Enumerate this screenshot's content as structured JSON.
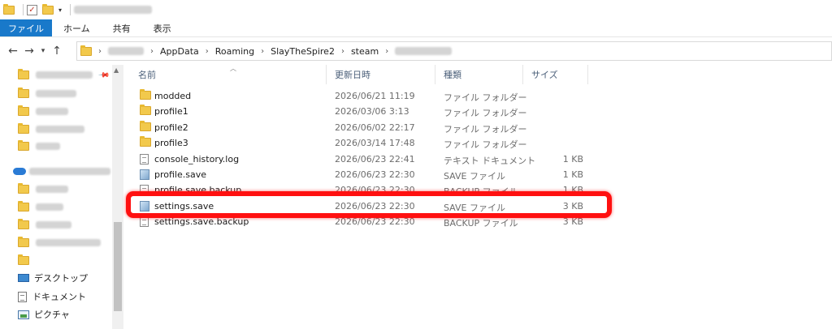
{
  "ribbon": {
    "tabs": [
      "ファイル",
      "ホーム",
      "共有",
      "表示"
    ]
  },
  "address": {
    "crumbs": [
      "AppData",
      "Roaming",
      "SlayTheSpire2",
      "steam"
    ]
  },
  "nav_pane": {
    "items": [
      "デスクトップ",
      "ドキュメント",
      "ピクチャ"
    ]
  },
  "columns": {
    "name": "名前",
    "date": "更新日時",
    "type": "種類",
    "size": "サイズ"
  },
  "files": [
    {
      "name": "modded",
      "date": "2026/06/21 11:19",
      "type": "ファイル フォルダー",
      "size": "",
      "icon": "folder-icon"
    },
    {
      "name": "profile1",
      "date": "2026/03/06 3:13",
      "type": "ファイル フォルダー",
      "size": "",
      "icon": "folder-icon"
    },
    {
      "name": "profile2",
      "date": "2026/06/02 22:17",
      "type": "ファイル フォルダー",
      "size": "",
      "icon": "folder-icon"
    },
    {
      "name": "profile3",
      "date": "2026/03/14 17:48",
      "type": "ファイル フォルダー",
      "size": "",
      "icon": "folder-icon"
    },
    {
      "name": "console_history.log",
      "date": "2026/06/23 22:41",
      "type": "テキスト ドキュメント",
      "size": "1 KB",
      "icon": "text-file-icon"
    },
    {
      "name": "profile.save",
      "date": "2026/06/23 22:30",
      "type": "SAVE ファイル",
      "size": "1 KB",
      "icon": "save-file-icon"
    },
    {
      "name": "profile.save.backup",
      "date": "2026/06/23 22:30",
      "type": "BACKUP ファイル",
      "size": "1 KB",
      "icon": "text-file-icon"
    },
    {
      "name": "settings.save",
      "date": "2026/06/23 22:30",
      "type": "SAVE ファイル",
      "size": "3 KB",
      "icon": "save-file-icon"
    },
    {
      "name": "settings.save.backup",
      "date": "2026/06/23 22:30",
      "type": "BACKUP ファイル",
      "size": "3 KB",
      "icon": "text-file-icon"
    }
  ],
  "colors": {
    "ribbon_file_tab": "#1979ca",
    "highlight": "#ff1010",
    "folder": "#f2c94c"
  }
}
